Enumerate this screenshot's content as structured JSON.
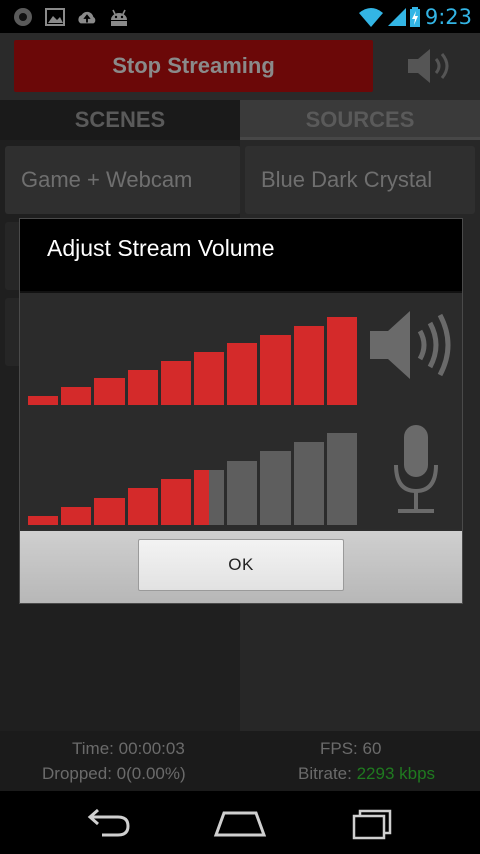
{
  "status_bar": {
    "time": "9:23",
    "left_icons": [
      "app-notification-icon",
      "image-icon",
      "cloud-upload-icon",
      "android-icon"
    ],
    "right_icons": [
      "wifi-icon",
      "signal-icon",
      "battery-charging-icon"
    ],
    "accent_color": "#33b5e5"
  },
  "app": {
    "stop_streaming_label": "Stop Streaming",
    "stop_streaming_color": "#8b0000",
    "tabs": [
      {
        "label": "SCENES"
      },
      {
        "label": "SOURCES"
      }
    ],
    "scenes": [
      "Game + Webcam"
    ],
    "sources": [
      "Blue Dark Crystal"
    ],
    "stats": {
      "time_label": "Time:",
      "time_value": "00:00:03",
      "dropped_label": "Dropped:",
      "dropped_value": "0(0.00%)",
      "fps_label": "FPS:",
      "fps_value": "60",
      "bitrate_label": "Bitrate:",
      "bitrate_value": "2293 kbps",
      "bitrate_color": "#2ca02c"
    }
  },
  "dialog": {
    "title": "Adjust Stream Volume",
    "ok_label": "OK",
    "stream_volume": {
      "level": 10,
      "total_bars": 10,
      "icon": "speaker-icon"
    },
    "mic_volume": {
      "level": 5.5,
      "total_bars": 10,
      "icon": "microphone-icon"
    },
    "active_color": "#d42a2a",
    "inactive_color": "#5e5e5e"
  },
  "nav_bar": {
    "buttons": [
      "back-icon",
      "home-icon",
      "recent-apps-icon"
    ]
  }
}
